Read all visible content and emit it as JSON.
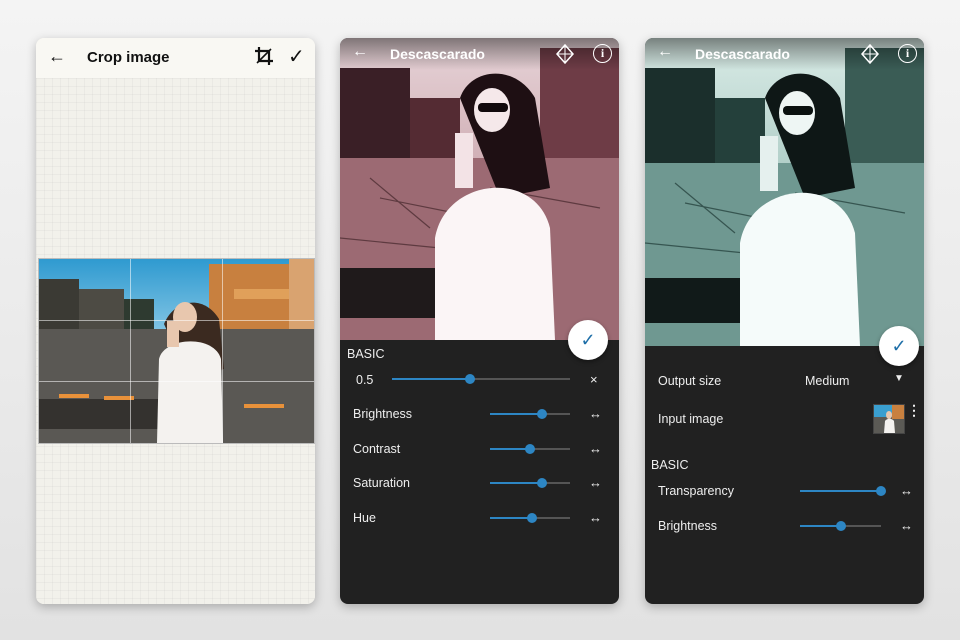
{
  "screen1": {
    "title": "Crop image",
    "back_icon": "arrow-left-icon",
    "crop_icon": "crop-icon",
    "confirm_icon": "checkmark-icon"
  },
  "screen2": {
    "title": "Descascarado",
    "tint": "#d7a0a8",
    "section": "BASIC",
    "value_label": "0.5",
    "main_slider_level": 0.44,
    "close_symbol": "×",
    "reset_symbol": "↔",
    "fab_symbol": "✓",
    "sliders": [
      {
        "label": "Brightness",
        "level": 0.65
      },
      {
        "label": "Contrast",
        "level": 0.5
      },
      {
        "label": "Saturation",
        "level": 0.65
      },
      {
        "label": "Hue",
        "level": 0.53
      }
    ]
  },
  "screen3": {
    "title": "Descascarado",
    "tint": "#6fa59d",
    "output_label": "Output size",
    "output_value": "Medium",
    "input_label": "Input image",
    "section": "BASIC",
    "reset_symbol": "↔",
    "fab_symbol": "✓",
    "sliders": [
      {
        "label": "Transparency",
        "level": 1.0
      },
      {
        "label": "Brightness",
        "level": 0.5
      }
    ]
  },
  "colors": {
    "accent": "#2d86c4",
    "panel_bg": "#212121",
    "crop_bg": "#f3f2ec"
  }
}
